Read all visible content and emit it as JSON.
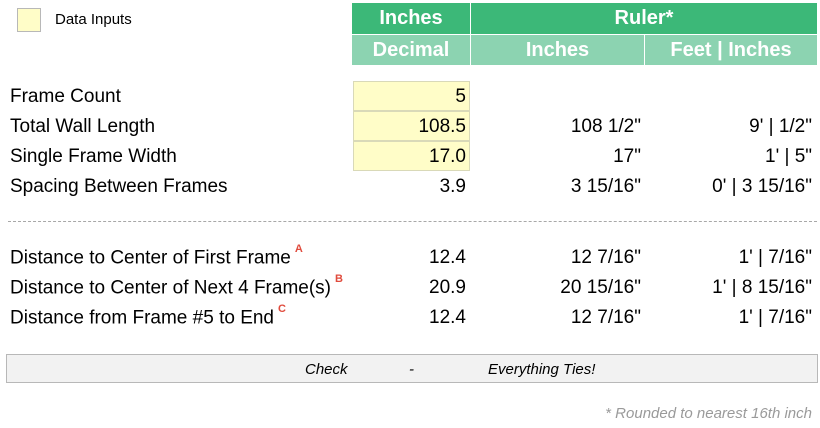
{
  "legend": {
    "label": "Data Inputs",
    "swatch_color": "#fffdc8"
  },
  "headers": {
    "top_left": "Inches",
    "top_right": "Ruler*",
    "sub_decimal": "Decimal",
    "sub_inches": "Inches",
    "sub_feet": "Feet | Inches"
  },
  "colors": {
    "header_dark": "#3cb878",
    "header_light": "#8cd3b1",
    "input_fill": "#fffdc8",
    "note_red": "#e04b3d"
  },
  "rows": [
    {
      "label": "Frame Count",
      "decimal": "5",
      "inches": "",
      "feet_inches": "",
      "note": ""
    },
    {
      "label": "Total Wall Length",
      "decimal": "108.5",
      "inches": "108 1/2\"",
      "feet_inches": "9' |  1/2\"",
      "note": ""
    },
    {
      "label": "Single Frame Width",
      "decimal": "17.0",
      "inches": "17\"",
      "feet_inches": "1' | 5\"",
      "note": ""
    },
    {
      "label": "Spacing Between Frames",
      "decimal": "3.9",
      "inches": "3 15/16\"",
      "feet_inches": "0' | 3 15/16\"",
      "note": ""
    },
    {
      "label": "Distance to Center of First Frame",
      "decimal": "12.4",
      "inches": "12 7/16\"",
      "feet_inches": "1' |  7/16\"",
      "note": "A"
    },
    {
      "label": "Distance to Center of Next 4 Frame(s)",
      "decimal": "20.9",
      "inches": "20 15/16\"",
      "feet_inches": "1' | 8 15/16\"",
      "note": "B"
    },
    {
      "label": "Distance from Frame #5 to End",
      "decimal": "12.4",
      "inches": "12 7/16\"",
      "feet_inches": "1' |  7/16\"",
      "note": "C"
    }
  ],
  "check": {
    "label": "Check",
    "dash": "-",
    "status": "Everything Ties!"
  },
  "footnote": "* Rounded to nearest 16th inch"
}
